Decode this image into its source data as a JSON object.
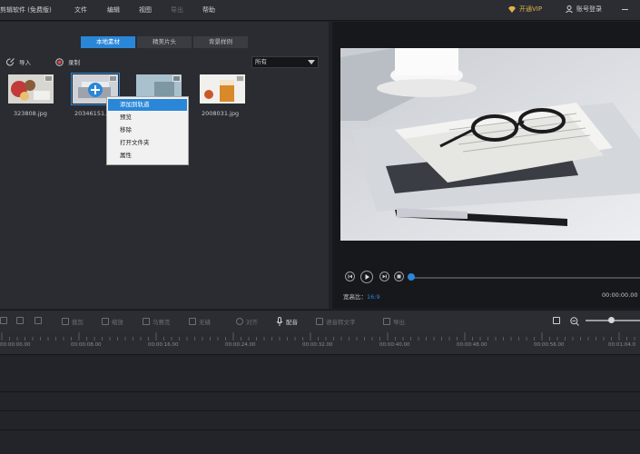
{
  "menubar": {
    "app_title": "剪辑软件 (免费版)",
    "items": [
      {
        "label": "文件",
        "enabled": true
      },
      {
        "label": "编辑",
        "enabled": true
      },
      {
        "label": "视图",
        "enabled": true
      },
      {
        "label": "导出",
        "enabled": false
      },
      {
        "label": "帮助",
        "enabled": true
      }
    ],
    "vip_label": "开通VIP",
    "login_label": "账号登录"
  },
  "media": {
    "tabs": [
      {
        "label": "本地素材",
        "active": true
      },
      {
        "label": "精美片头",
        "active": false
      },
      {
        "label": "背景样例",
        "active": false
      }
    ],
    "import_label": "导入",
    "record_label": "录制",
    "filter_value": "所有",
    "items": [
      {
        "name": "323808.jpg",
        "selected": false
      },
      {
        "name": "20346151.jpg",
        "selected": true
      },
      {
        "name": "",
        "selected": false
      },
      {
        "name": "2008031.jpg",
        "selected": false
      }
    ],
    "context_menu": [
      {
        "label": "添加到轨道",
        "highlighted": true
      },
      {
        "label": "预览",
        "highlighted": false
      },
      {
        "label": "移除",
        "highlighted": false
      },
      {
        "label": "打开文件夹",
        "highlighted": false
      },
      {
        "label": "属性",
        "highlighted": false
      }
    ]
  },
  "preview": {
    "ratio_label": "宽高比：",
    "ratio_value": "16:9",
    "timecode": "00:00:00.00",
    "progress": 0.0
  },
  "toolbar": {
    "tools": [
      {
        "label": "",
        "enabled": false
      },
      {
        "label": "",
        "enabled": false
      },
      {
        "label": "",
        "enabled": false
      },
      {
        "label": "裁剪",
        "enabled": false
      },
      {
        "label": "缩放",
        "enabled": false
      },
      {
        "label": "马赛克",
        "enabled": false
      },
      {
        "label": "无缝",
        "enabled": false
      },
      {
        "label": "对齐",
        "enabled": false
      },
      {
        "label": "配音",
        "enabled": true
      },
      {
        "label": "语音转文字",
        "enabled": false
      },
      {
        "label": "导出",
        "enabled": false
      }
    ]
  },
  "timeline": {
    "ticks": [
      "00:00:00.00",
      "00:00:08.00",
      "00:00:16.00",
      "00:00:24.00",
      "00:00:32.00",
      "00:00:40.00",
      "00:00:48.00",
      "00:00:56.00",
      "00:01:04.0"
    ]
  },
  "colors": {
    "accent": "#2a87d8",
    "vip": "#e0b24a"
  }
}
